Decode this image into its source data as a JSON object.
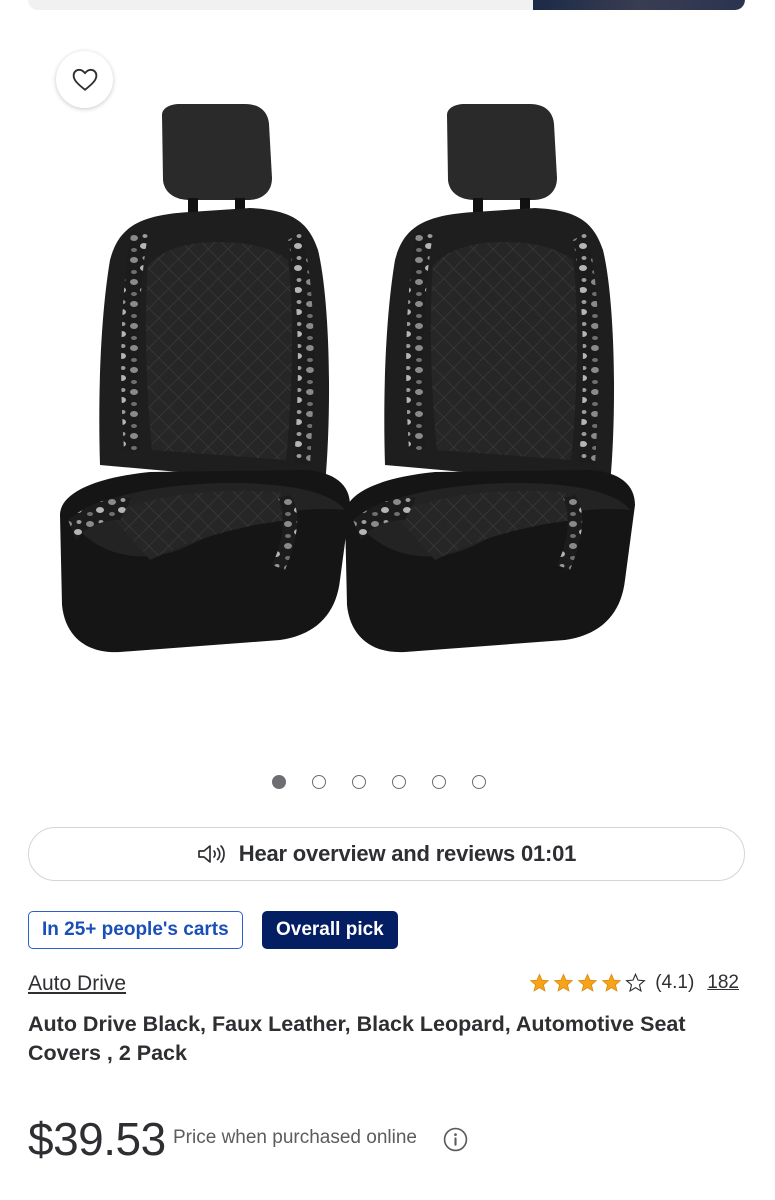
{
  "product": {
    "brand": "Auto Drive",
    "title": "Auto Drive Black, Faux Leather, Black Leopard, Automotive Seat Covers , 2 Pack",
    "price": "$39.53",
    "price_note": "Price when purchased online"
  },
  "badges": {
    "carts": "In 25+ people's carts",
    "pick": "Overall pick"
  },
  "audio": {
    "label": "Hear overview and reviews 01:01"
  },
  "rating": {
    "value": 4.1,
    "text": "(4.1)",
    "count": "182"
  },
  "gallery": {
    "total_images": 6,
    "active_index": 0
  },
  "icons": {
    "favorite": "heart-outline-icon",
    "audio": "speaker-icon",
    "info": "info-circle-icon",
    "star": "star-icon"
  },
  "colors": {
    "badge_pick_bg": "#041e63",
    "badge_carts_border": "#2a5fcc",
    "star": "#f6a31a"
  }
}
